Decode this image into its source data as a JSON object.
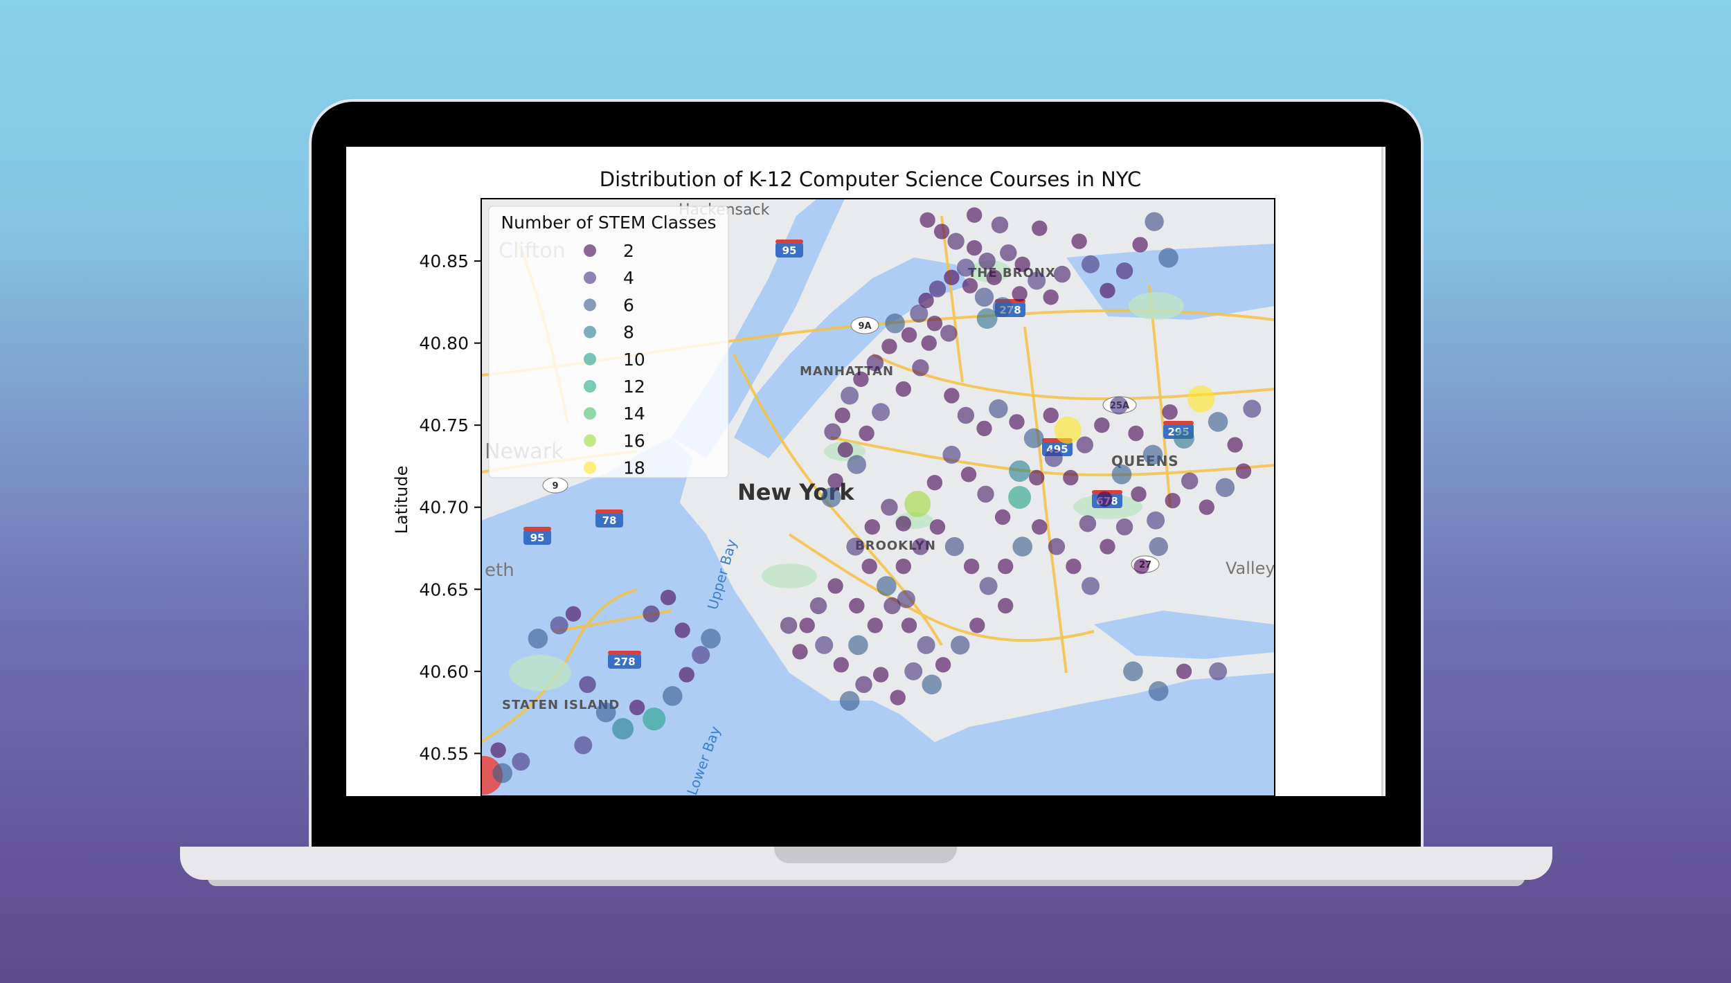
{
  "chart_data": {
    "type": "scatter",
    "title": "Distribution of K-12 Computer Science Courses in NYC",
    "xlabel": "",
    "ylabel": "Latitude",
    "xlim": [
      -74.26,
      -73.7
    ],
    "ylim": [
      40.524,
      40.888
    ],
    "yticks": [
      40.55,
      40.6,
      40.65,
      40.7,
      40.75,
      40.8,
      40.85
    ],
    "ytick_labels": [
      "40.55",
      "40.60",
      "40.65",
      "40.70",
      "40.75",
      "40.80",
      "40.85"
    ],
    "grid": false,
    "colormap": "viridis",
    "legend": {
      "title": "Number of STEM Classes",
      "placement": "upper left",
      "entries": [
        {
          "label": "2",
          "value": 2,
          "color": "#440154"
        },
        {
          "label": "4",
          "value": 4,
          "color": "#46337e"
        },
        {
          "label": "6",
          "value": 6,
          "color": "#365c8d"
        },
        {
          "label": "8",
          "value": 8,
          "color": "#277f8e"
        },
        {
          "label": "10",
          "value": 10,
          "color": "#1fa187"
        },
        {
          "label": "12",
          "value": 12,
          "color": "#25ab82"
        },
        {
          "label": "14",
          "value": 14,
          "color": "#4ac16d"
        },
        {
          "label": "16",
          "value": 16,
          "color": "#a0da39"
        },
        {
          "label": "18",
          "value": 18,
          "color": "#fde725"
        }
      ]
    },
    "points": [
      {
        "lon": -73.945,
        "lat": 40.875,
        "v": 2
      },
      {
        "lon": -73.935,
        "lat": 40.868,
        "v": 2
      },
      {
        "lon": -73.925,
        "lat": 40.862,
        "v": 3
      },
      {
        "lon": -73.912,
        "lat": 40.858,
        "v": 2
      },
      {
        "lon": -73.903,
        "lat": 40.85,
        "v": 3
      },
      {
        "lon": -73.918,
        "lat": 40.846,
        "v": 4
      },
      {
        "lon": -73.928,
        "lat": 40.84,
        "v": 2
      },
      {
        "lon": -73.938,
        "lat": 40.833,
        "v": 3
      },
      {
        "lon": -73.946,
        "lat": 40.826,
        "v": 2
      },
      {
        "lon": -73.951,
        "lat": 40.818,
        "v": 4
      },
      {
        "lon": -73.94,
        "lat": 40.812,
        "v": 2
      },
      {
        "lon": -73.93,
        "lat": 40.806,
        "v": 3
      },
      {
        "lon": -73.915,
        "lat": 40.835,
        "v": 2
      },
      {
        "lon": -73.905,
        "lat": 40.828,
        "v": 5
      },
      {
        "lon": -73.898,
        "lat": 40.84,
        "v": 2
      },
      {
        "lon": -73.888,
        "lat": 40.855,
        "v": 3
      },
      {
        "lon": -73.878,
        "lat": 40.848,
        "v": 2
      },
      {
        "lon": -73.868,
        "lat": 40.838,
        "v": 4
      },
      {
        "lon": -73.88,
        "lat": 40.83,
        "v": 2
      },
      {
        "lon": -73.892,
        "lat": 40.822,
        "v": 6
      },
      {
        "lon": -73.903,
        "lat": 40.815,
        "v": 7
      },
      {
        "lon": -73.858,
        "lat": 40.828,
        "v": 2
      },
      {
        "lon": -73.85,
        "lat": 40.842,
        "v": 3
      },
      {
        "lon": -73.838,
        "lat": 40.862,
        "v": 2
      },
      {
        "lon": -73.83,
        "lat": 40.848,
        "v": 4
      },
      {
        "lon": -73.818,
        "lat": 40.832,
        "v": 2
      },
      {
        "lon": -73.806,
        "lat": 40.844,
        "v": 3
      },
      {
        "lon": -73.795,
        "lat": 40.86,
        "v": 2
      },
      {
        "lon": -73.785,
        "lat": 40.874,
        "v": 5
      },
      {
        "lon": -73.775,
        "lat": 40.852,
        "v": 6
      },
      {
        "lon": -73.866,
        "lat": 40.87,
        "v": 2
      },
      {
        "lon": -73.894,
        "lat": 40.872,
        "v": 3
      },
      {
        "lon": -73.912,
        "lat": 40.878,
        "v": 2
      },
      {
        "lon": -73.972,
        "lat": 40.798,
        "v": 2
      },
      {
        "lon": -73.982,
        "lat": 40.788,
        "v": 3
      },
      {
        "lon": -73.992,
        "lat": 40.778,
        "v": 2
      },
      {
        "lon": -74.0,
        "lat": 40.768,
        "v": 4
      },
      {
        "lon": -74.005,
        "lat": 40.756,
        "v": 2
      },
      {
        "lon": -74.012,
        "lat": 40.746,
        "v": 3
      },
      {
        "lon": -74.003,
        "lat": 40.735,
        "v": 2
      },
      {
        "lon": -73.995,
        "lat": 40.726,
        "v": 5
      },
      {
        "lon": -74.01,
        "lat": 40.716,
        "v": 2
      },
      {
        "lon": -74.013,
        "lat": 40.706,
        "v": 6
      },
      {
        "lon": -73.988,
        "lat": 40.745,
        "v": 2
      },
      {
        "lon": -73.978,
        "lat": 40.758,
        "v": 4
      },
      {
        "lon": -73.962,
        "lat": 40.772,
        "v": 2
      },
      {
        "lon": -73.95,
        "lat": 40.785,
        "v": 3
      },
      {
        "lon": -73.944,
        "lat": 40.8,
        "v": 2
      },
      {
        "lon": -73.968,
        "lat": 40.812,
        "v": 6
      },
      {
        "lon": -73.958,
        "lat": 40.805,
        "v": 2
      },
      {
        "lon": -73.928,
        "lat": 40.768,
        "v": 2
      },
      {
        "lon": -73.918,
        "lat": 40.756,
        "v": 3
      },
      {
        "lon": -73.905,
        "lat": 40.748,
        "v": 2
      },
      {
        "lon": -73.895,
        "lat": 40.76,
        "v": 5
      },
      {
        "lon": -73.882,
        "lat": 40.752,
        "v": 2
      },
      {
        "lon": -73.87,
        "lat": 40.742,
        "v": 6
      },
      {
        "lon": -73.858,
        "lat": 40.756,
        "v": 2
      },
      {
        "lon": -73.846,
        "lat": 40.747,
        "v": 18
      },
      {
        "lon": -73.834,
        "lat": 40.738,
        "v": 3
      },
      {
        "lon": -73.822,
        "lat": 40.75,
        "v": 2
      },
      {
        "lon": -73.81,
        "lat": 40.762,
        "v": 4
      },
      {
        "lon": -73.798,
        "lat": 40.745,
        "v": 2
      },
      {
        "lon": -73.786,
        "lat": 40.732,
        "v": 6
      },
      {
        "lon": -73.774,
        "lat": 40.758,
        "v": 2
      },
      {
        "lon": -73.764,
        "lat": 40.742,
        "v": 7
      },
      {
        "lon": -73.752,
        "lat": 40.766,
        "v": 18
      },
      {
        "lon": -73.74,
        "lat": 40.752,
        "v": 6
      },
      {
        "lon": -73.728,
        "lat": 40.738,
        "v": 2
      },
      {
        "lon": -73.716,
        "lat": 40.76,
        "v": 4
      },
      {
        "lon": -73.722,
        "lat": 40.722,
        "v": 2
      },
      {
        "lon": -73.735,
        "lat": 40.712,
        "v": 5
      },
      {
        "lon": -73.748,
        "lat": 40.7,
        "v": 2
      },
      {
        "lon": -73.76,
        "lat": 40.716,
        "v": 3
      },
      {
        "lon": -73.772,
        "lat": 40.704,
        "v": 2
      },
      {
        "lon": -73.784,
        "lat": 40.692,
        "v": 4
      },
      {
        "lon": -73.796,
        "lat": 40.708,
        "v": 2
      },
      {
        "lon": -73.808,
        "lat": 40.72,
        "v": 6
      },
      {
        "lon": -73.82,
        "lat": 40.705,
        "v": 2
      },
      {
        "lon": -73.832,
        "lat": 40.69,
        "v": 3
      },
      {
        "lon": -73.844,
        "lat": 40.718,
        "v": 2
      },
      {
        "lon": -73.856,
        "lat": 40.73,
        "v": 4
      },
      {
        "lon": -73.868,
        "lat": 40.718,
        "v": 2
      },
      {
        "lon": -73.88,
        "lat": 40.706,
        "v": 10
      },
      {
        "lon": -73.88,
        "lat": 40.722,
        "v": 8
      },
      {
        "lon": -73.892,
        "lat": 40.694,
        "v": 2
      },
      {
        "lon": -73.904,
        "lat": 40.708,
        "v": 3
      },
      {
        "lon": -73.916,
        "lat": 40.72,
        "v": 2
      },
      {
        "lon": -73.928,
        "lat": 40.732,
        "v": 4
      },
      {
        "lon": -73.94,
        "lat": 40.715,
        "v": 2
      },
      {
        "lon": -73.952,
        "lat": 40.702,
        "v": 16
      },
      {
        "lon": -73.962,
        "lat": 40.69,
        "v": 2
      },
      {
        "lon": -73.972,
        "lat": 40.7,
        "v": 3
      },
      {
        "lon": -73.984,
        "lat": 40.688,
        "v": 2
      },
      {
        "lon": -73.996,
        "lat": 40.676,
        "v": 4
      },
      {
        "lon": -73.986,
        "lat": 40.664,
        "v": 2
      },
      {
        "lon": -73.974,
        "lat": 40.652,
        "v": 6
      },
      {
        "lon": -73.962,
        "lat": 40.664,
        "v": 2
      },
      {
        "lon": -73.95,
        "lat": 40.676,
        "v": 3
      },
      {
        "lon": -73.938,
        "lat": 40.688,
        "v": 2
      },
      {
        "lon": -73.926,
        "lat": 40.676,
        "v": 5
      },
      {
        "lon": -73.914,
        "lat": 40.664,
        "v": 2
      },
      {
        "lon": -73.902,
        "lat": 40.652,
        "v": 4
      },
      {
        "lon": -73.89,
        "lat": 40.664,
        "v": 2
      },
      {
        "lon": -73.878,
        "lat": 40.676,
        "v": 6
      },
      {
        "lon": -73.866,
        "lat": 40.688,
        "v": 2
      },
      {
        "lon": -73.854,
        "lat": 40.676,
        "v": 3
      },
      {
        "lon": -73.842,
        "lat": 40.664,
        "v": 2
      },
      {
        "lon": -73.83,
        "lat": 40.652,
        "v": 4
      },
      {
        "lon": -73.818,
        "lat": 40.676,
        "v": 2
      },
      {
        "lon": -73.806,
        "lat": 40.688,
        "v": 3
      },
      {
        "lon": -73.794,
        "lat": 40.664,
        "v": 2
      },
      {
        "lon": -73.782,
        "lat": 40.676,
        "v": 5
      },
      {
        "lon": -74.01,
        "lat": 40.652,
        "v": 2
      },
      {
        "lon": -74.022,
        "lat": 40.64,
        "v": 3
      },
      {
        "lon": -74.03,
        "lat": 40.628,
        "v": 2
      },
      {
        "lon": -74.018,
        "lat": 40.616,
        "v": 4
      },
      {
        "lon": -74.006,
        "lat": 40.604,
        "v": 2
      },
      {
        "lon": -73.994,
        "lat": 40.616,
        "v": 6
      },
      {
        "lon": -73.982,
        "lat": 40.628,
        "v": 2
      },
      {
        "lon": -73.97,
        "lat": 40.64,
        "v": 3
      },
      {
        "lon": -73.958,
        "lat": 40.628,
        "v": 2
      },
      {
        "lon": -73.946,
        "lat": 40.616,
        "v": 4
      },
      {
        "lon": -73.934,
        "lat": 40.604,
        "v": 2
      },
      {
        "lon": -73.922,
        "lat": 40.616,
        "v": 5
      },
      {
        "lon": -73.91,
        "lat": 40.628,
        "v": 2
      },
      {
        "lon": -73.942,
        "lat": 40.592,
        "v": 6
      },
      {
        "lon": -73.966,
        "lat": 40.584,
        "v": 2
      },
      {
        "lon": -73.99,
        "lat": 40.592,
        "v": 3
      },
      {
        "lon": -74.0,
        "lat": 40.582,
        "v": 6
      },
      {
        "lon": -73.978,
        "lat": 40.598,
        "v": 2
      },
      {
        "lon": -73.955,
        "lat": 40.6,
        "v": 4
      },
      {
        "lon": -74.035,
        "lat": 40.612,
        "v": 2
      },
      {
        "lon": -74.043,
        "lat": 40.628,
        "v": 3
      },
      {
        "lon": -73.995,
        "lat": 40.64,
        "v": 2
      },
      {
        "lon": -73.96,
        "lat": 40.644,
        "v": 4
      },
      {
        "lon": -73.89,
        "lat": 40.64,
        "v": 2
      },
      {
        "lon": -73.8,
        "lat": 40.6,
        "v": 6
      },
      {
        "lon": -73.782,
        "lat": 40.588,
        "v": 6
      },
      {
        "lon": -73.764,
        "lat": 40.6,
        "v": 2
      },
      {
        "lon": -73.74,
        "lat": 40.6,
        "v": 4
      },
      {
        "lon": -74.245,
        "lat": 40.538,
        "v": 6
      },
      {
        "lon": -74.232,
        "lat": 40.545,
        "v": 4
      },
      {
        "lon": -74.22,
        "lat": 40.62,
        "v": 6
      },
      {
        "lon": -74.205,
        "lat": 40.628,
        "v": 4
      },
      {
        "lon": -74.195,
        "lat": 40.635,
        "v": 2
      },
      {
        "lon": -74.185,
        "lat": 40.592,
        "v": 3
      },
      {
        "lon": -74.172,
        "lat": 40.575,
        "v": 6
      },
      {
        "lon": -74.16,
        "lat": 40.565,
        "v": 8
      },
      {
        "lon": -74.15,
        "lat": 40.578,
        "v": 2
      },
      {
        "lon": -74.138,
        "lat": 40.571,
        "v": 10
      },
      {
        "lon": -74.125,
        "lat": 40.585,
        "v": 6
      },
      {
        "lon": -74.115,
        "lat": 40.598,
        "v": 2
      },
      {
        "lon": -74.105,
        "lat": 40.61,
        "v": 4
      },
      {
        "lon": -74.098,
        "lat": 40.62,
        "v": 6
      },
      {
        "lon": -74.118,
        "lat": 40.625,
        "v": 2
      },
      {
        "lon": -74.14,
        "lat": 40.635,
        "v": 3
      },
      {
        "lon": -74.128,
        "lat": 40.645,
        "v": 2
      },
      {
        "lon": -74.188,
        "lat": 40.555,
        "v": 4
      },
      {
        "lon": -74.248,
        "lat": 40.552,
        "v": 2
      }
    ]
  }
}
